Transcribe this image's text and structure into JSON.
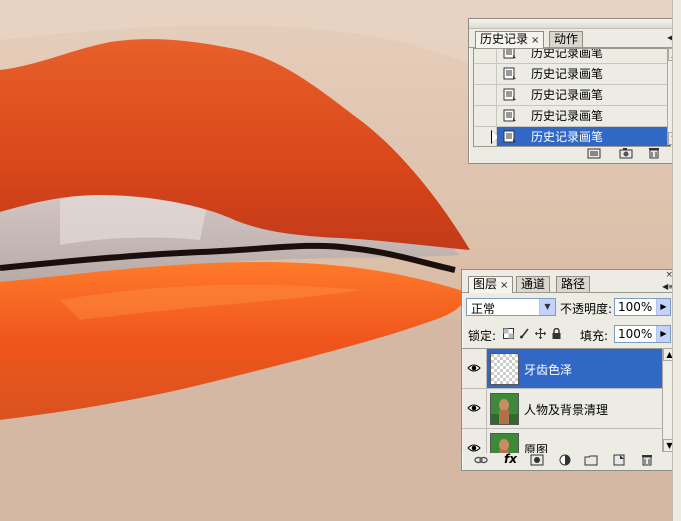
{
  "history_panel": {
    "tabs": [
      {
        "label": "历史记录",
        "active": true,
        "has_close": true
      },
      {
        "label": "动作",
        "active": false
      }
    ],
    "close_glyph": "×",
    "states": [
      {
        "label": "历史记录画笔",
        "selected": false,
        "icon": "history-brush-icon"
      },
      {
        "label": "历史记录画笔",
        "selected": false,
        "icon": "history-brush-icon"
      },
      {
        "label": "历史记录画笔",
        "selected": false,
        "icon": "history-brush-icon"
      },
      {
        "label": "历史记录画笔",
        "selected": false,
        "icon": "history-brush-icon"
      },
      {
        "label": "历史记录画笔",
        "selected": true,
        "icon": "history-brush-icon"
      }
    ],
    "footer_icons": [
      "new-document-from-state-icon",
      "snapshot-camera-icon",
      "trash-icon"
    ]
  },
  "layers_panel": {
    "tabs": [
      {
        "label": "图层",
        "active": true,
        "has_close": true
      },
      {
        "label": "通道",
        "active": false
      },
      {
        "label": "路径",
        "active": false
      }
    ],
    "close_glyph": "×",
    "blend_mode": "正常",
    "opacity_label": "不透明度:",
    "opacity_value": "100%",
    "lock_label": "锁定:",
    "fill_label": "填充:",
    "fill_value": "100%",
    "layers": [
      {
        "name": "牙齿色泽",
        "visible": true,
        "selected": true,
        "thumb": "transparent"
      },
      {
        "name": "人物及背景清理",
        "visible": true,
        "selected": false,
        "thumb": "photo"
      },
      {
        "name": "原图",
        "visible": true,
        "selected": false,
        "thumb": "photo"
      }
    ],
    "footer_fx": "fx",
    "footer_icons": [
      "link-layers-icon",
      "layer-style-fx-icon",
      "layer-mask-icon",
      "adjustment-layer-icon",
      "group-folder-icon",
      "new-layer-icon",
      "trash-icon"
    ]
  },
  "colors": {
    "selection": "#3168c6",
    "panel_bg": "#ecebe4",
    "lip_orange": "#e8551e"
  }
}
